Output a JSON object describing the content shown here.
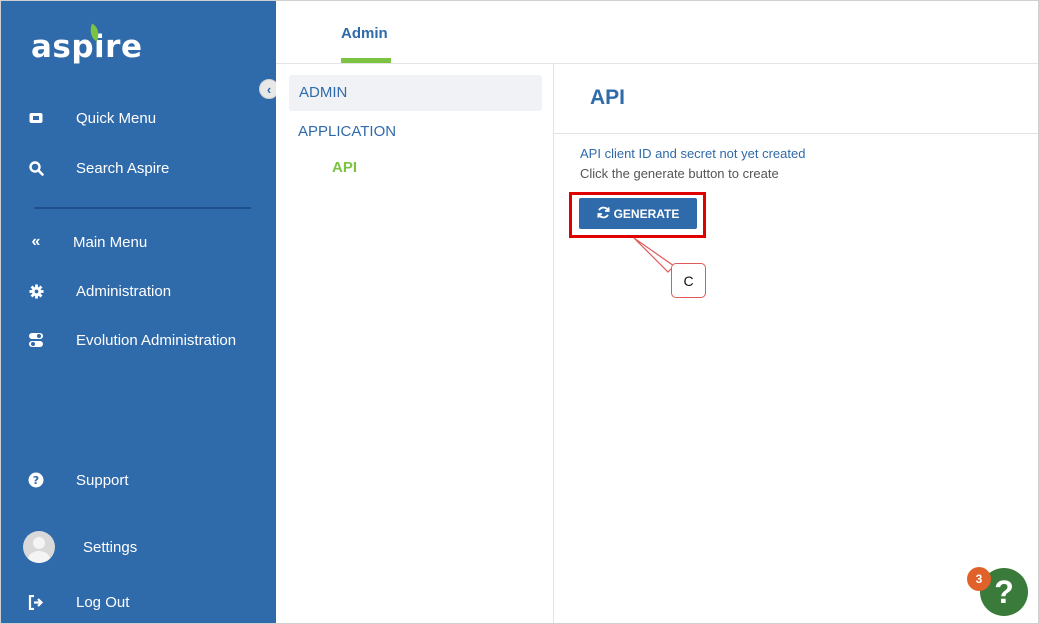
{
  "brand": {
    "logo_text": "aspire",
    "accent_color": "#7cc243",
    "primary_color": "#2f6aaa"
  },
  "sidebar": {
    "items": [
      {
        "label": "Quick Menu",
        "icon": "quick-menu-icon"
      },
      {
        "label": "Search Aspire",
        "icon": "search-icon"
      },
      {
        "label": "Main Menu",
        "icon": "double-chevron-left-icon"
      },
      {
        "label": "Administration",
        "icon": "gear-icon"
      },
      {
        "label": "Evolution Administration",
        "icon": "toggle-icon"
      },
      {
        "label": "Support",
        "icon": "question-circle-icon"
      },
      {
        "label": "Settings",
        "icon": "avatar"
      },
      {
        "label": "Log Out",
        "icon": "logout-icon"
      }
    ]
  },
  "header": {
    "tabs": [
      {
        "label": "Admin",
        "active": true
      }
    ]
  },
  "nav_panel": {
    "admin": "ADMIN",
    "application": "APPLICATION",
    "api": "API"
  },
  "main": {
    "title": "API",
    "message_primary": "API client ID and secret not yet created",
    "message_secondary": "Click the generate button to create",
    "generate_button": "GENERATE",
    "callout_label": "C"
  },
  "help": {
    "badge_count": "3",
    "label": "?"
  }
}
